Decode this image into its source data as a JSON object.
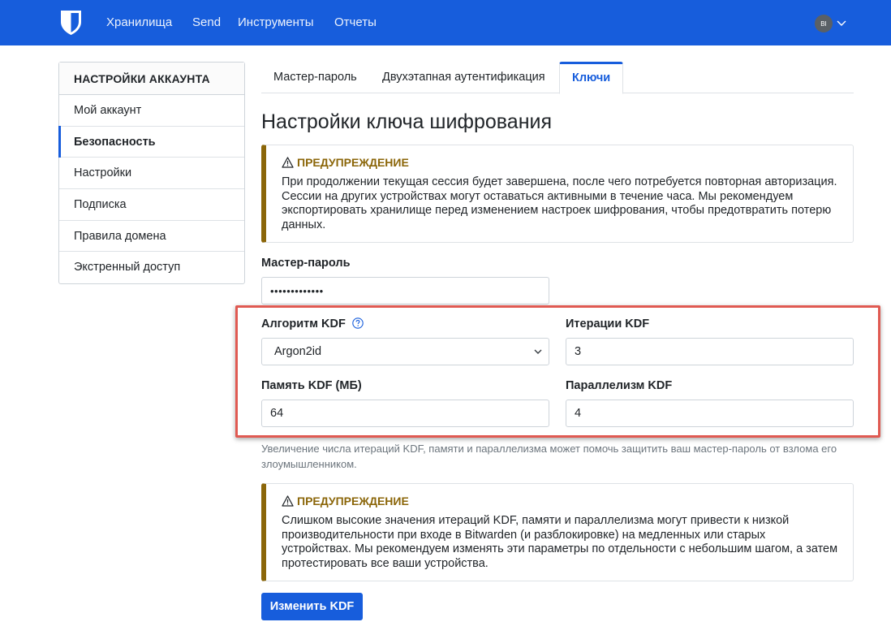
{
  "navbar": {
    "items": [
      "Хранилища",
      "Send",
      "Инструменты",
      "Отчеты"
    ],
    "avatar_initials": "BI",
    "brand_icon": "bitwarden-shield-icon",
    "bg_color": "#175ddc"
  },
  "sidebar": {
    "title": "НАСТРОЙКИ АККАУНТА",
    "items": [
      "Мой аккаунт",
      "Безопасность",
      "Настройки",
      "Подписка",
      "Правила домена",
      "Экстренный доступ"
    ],
    "active": "Безопасность"
  },
  "tabs": {
    "items": [
      "Мастер-пароль",
      "Двухэтапная аутентификация",
      "Ключи"
    ],
    "active": "Ключи"
  },
  "page": {
    "title": "Настройки ключа шифрования"
  },
  "warning1": {
    "title": "ПРЕДУПРЕЖДЕНИЕ",
    "body": "При продолжении текущая сессия будет завершена, после чего потребуется повторная авторизация. Сессии на других устройствах могут оставаться активными в течение часа. Мы рекомендуем экспортировать хранилище перед изменением настроек шифрования, чтобы предотвратить потерю данных."
  },
  "form": {
    "master_password_label": "Мастер-пароль",
    "master_password_value": "•••••••••••••",
    "kdf_algorithm_label": "Алгоритм KDF",
    "kdf_algorithm_value": "Argon2id",
    "kdf_iterations_label": "Итерации KDF",
    "kdf_iterations_value": "3",
    "kdf_memory_label": "Память KDF (МБ)",
    "kdf_memory_value": "64",
    "kdf_parallelism_label": "Параллелизм KDF",
    "kdf_parallelism_value": "4",
    "hint": "Увеличение числа итераций KDF, памяти и параллелизма может помочь защитить ваш мастер-пароль от взлома его злоумышленником."
  },
  "warning2": {
    "title": "ПРЕДУПРЕЖДЕНИЕ",
    "body": "Слишком высокие значения итераций KDF, памяти и параллелизма могут привести к низкой производительности при входе в Bitwarden (и разблокировке) на медленных или старых устройствах. Мы рекомендуем изменять эти параметры по отдельности с небольшим шагом, а затем протестировать все ваши устройства."
  },
  "actions": {
    "submit_label": "Изменить KDF"
  },
  "colors": {
    "primary": "#175ddc",
    "warning": "#8b6609",
    "highlight": "#e05a52"
  }
}
